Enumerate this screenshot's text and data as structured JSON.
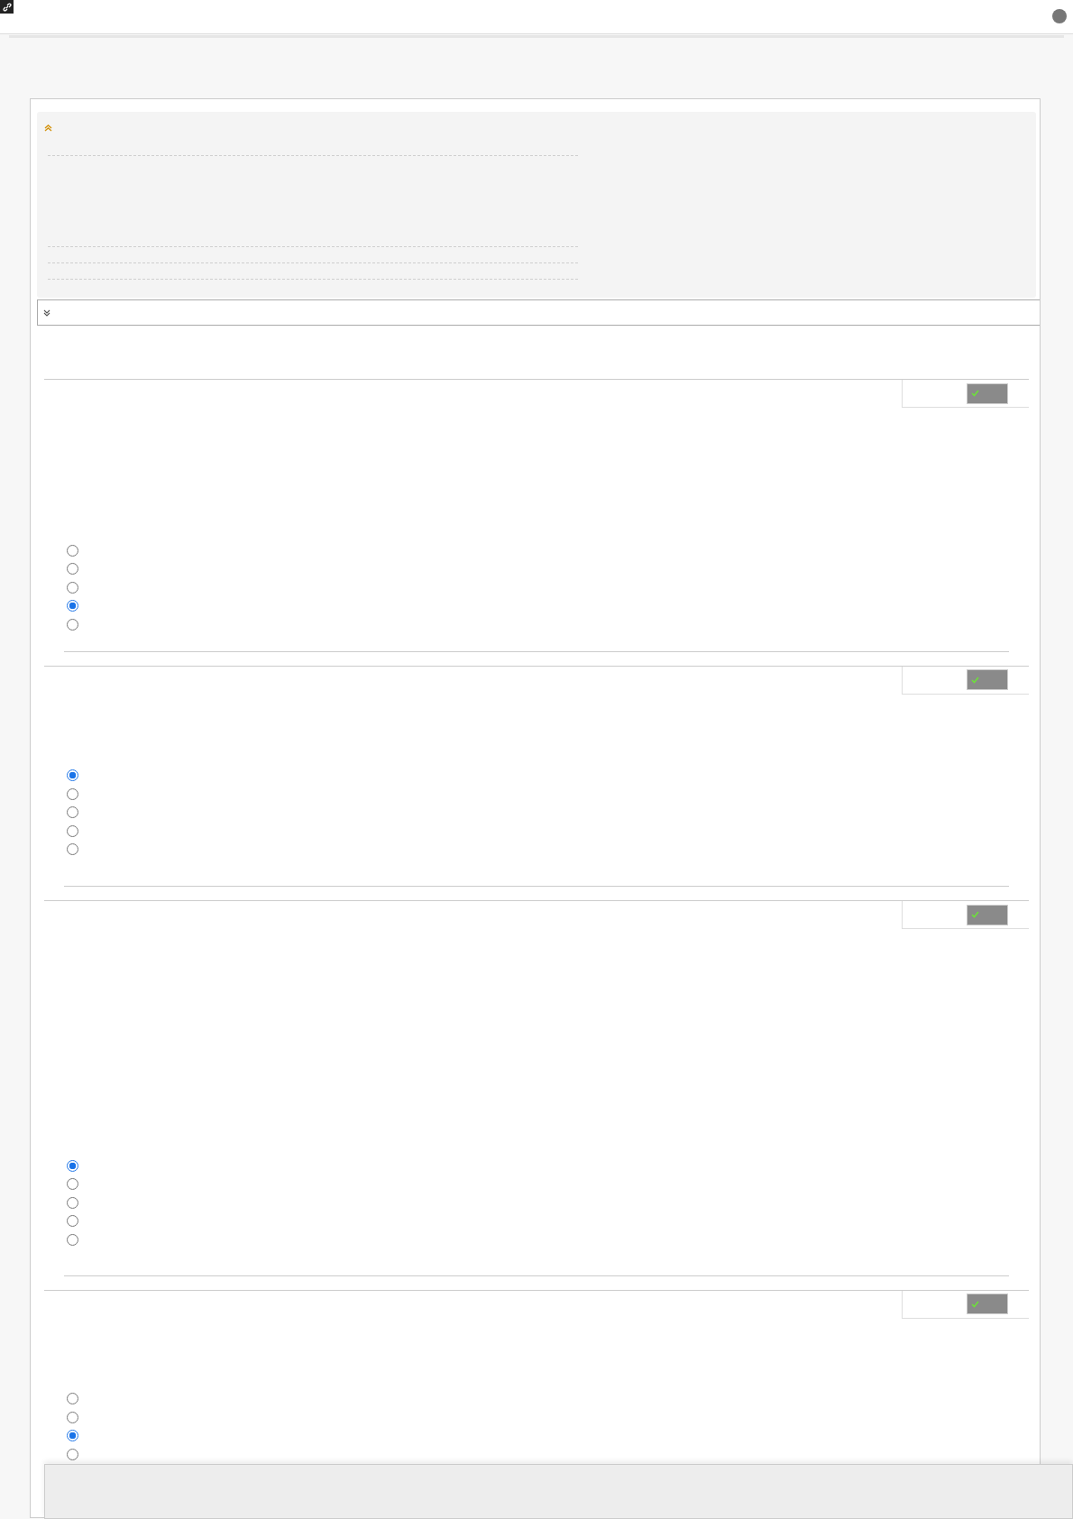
{
  "questions": [
    {
      "options": [
        {
          "selected": false
        },
        {
          "selected": false
        },
        {
          "selected": false
        },
        {
          "selected": true
        },
        {
          "selected": false
        }
      ]
    },
    {
      "options": [
        {
          "selected": true
        },
        {
          "selected": false
        },
        {
          "selected": false
        },
        {
          "selected": false
        },
        {
          "selected": false
        }
      ]
    },
    {
      "options": [
        {
          "selected": true
        },
        {
          "selected": false
        },
        {
          "selected": false
        },
        {
          "selected": false
        },
        {
          "selected": false
        }
      ]
    },
    {
      "options": [
        {
          "selected": false
        },
        {
          "selected": false
        },
        {
          "selected": true
        },
        {
          "selected": false
        }
      ]
    }
  ]
}
